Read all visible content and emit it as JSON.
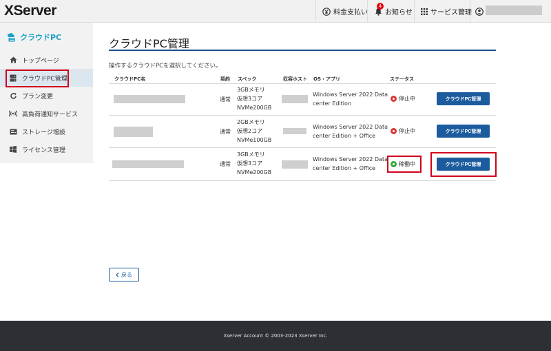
{
  "header": {
    "logo": "XServer",
    "nav": [
      {
        "label": "料金支払い",
        "icon": "yen-icon"
      },
      {
        "label": "お知らせ",
        "icon": "bell-icon",
        "badge": "4"
      },
      {
        "label": "サービス管理",
        "icon": "grid-icon"
      }
    ],
    "user_icon": "user-icon"
  },
  "sidebar": {
    "title": "クラウドPC",
    "items": [
      {
        "label": "トップページ",
        "icon": "home-icon"
      },
      {
        "label": "クラウドPC管理",
        "icon": "server-icon"
      },
      {
        "label": "プラン変更",
        "icon": "refresh-icon"
      },
      {
        "label": "高負荷通知サービス",
        "icon": "signal-icon"
      },
      {
        "label": "ストレージ増設",
        "icon": "storage-icon"
      },
      {
        "label": "ライセンス管理",
        "icon": "windows-icon"
      }
    ]
  },
  "main": {
    "title": "クラウドPC管理",
    "instruction": "操作するクラウドPCを選択してください。",
    "columns": [
      "クラウドPC名",
      "契約",
      "スペック",
      "収容ホスト",
      "OS・アプリ",
      "ステータス"
    ],
    "rows": [
      {
        "contract": "通常",
        "spec": [
          "3GBメモリ",
          "仮想3コア",
          "NVMe200GB"
        ],
        "os": [
          "Windows Server 2022 Data",
          "center Edition"
        ],
        "status": "停止中",
        "status_type": "stopped",
        "button": "クラウドPC管理"
      },
      {
        "contract": "通常",
        "spec": [
          "2GBメモリ",
          "仮想2コア",
          "NVMe100GB"
        ],
        "os": [
          "Windows Server 2022 Data",
          "center Edition + Office"
        ],
        "status": "停止中",
        "status_type": "stopped",
        "button": "クラウドPC管理"
      },
      {
        "contract": "通常",
        "spec": [
          "3GBメモリ",
          "仮想3コア",
          "NVMe200GB"
        ],
        "os": [
          "Windows Server 2022 Data",
          "center Edition + Office"
        ],
        "status": "稼働中",
        "status_type": "running",
        "button": "クラウドPC管理"
      }
    ],
    "back_label": "戻る"
  },
  "footer": {
    "copyright": "Xserver Account © 2003-2023 Xserver Inc."
  },
  "colors": {
    "brand": "#1aa0c8",
    "primary_button": "#1b5b9e",
    "title_rule": "#1e4f84",
    "highlight_box": "#d0021b",
    "status_stopped": "#d93a36",
    "status_running": "#2fae3e",
    "footer_bg": "#2c2f33"
  }
}
